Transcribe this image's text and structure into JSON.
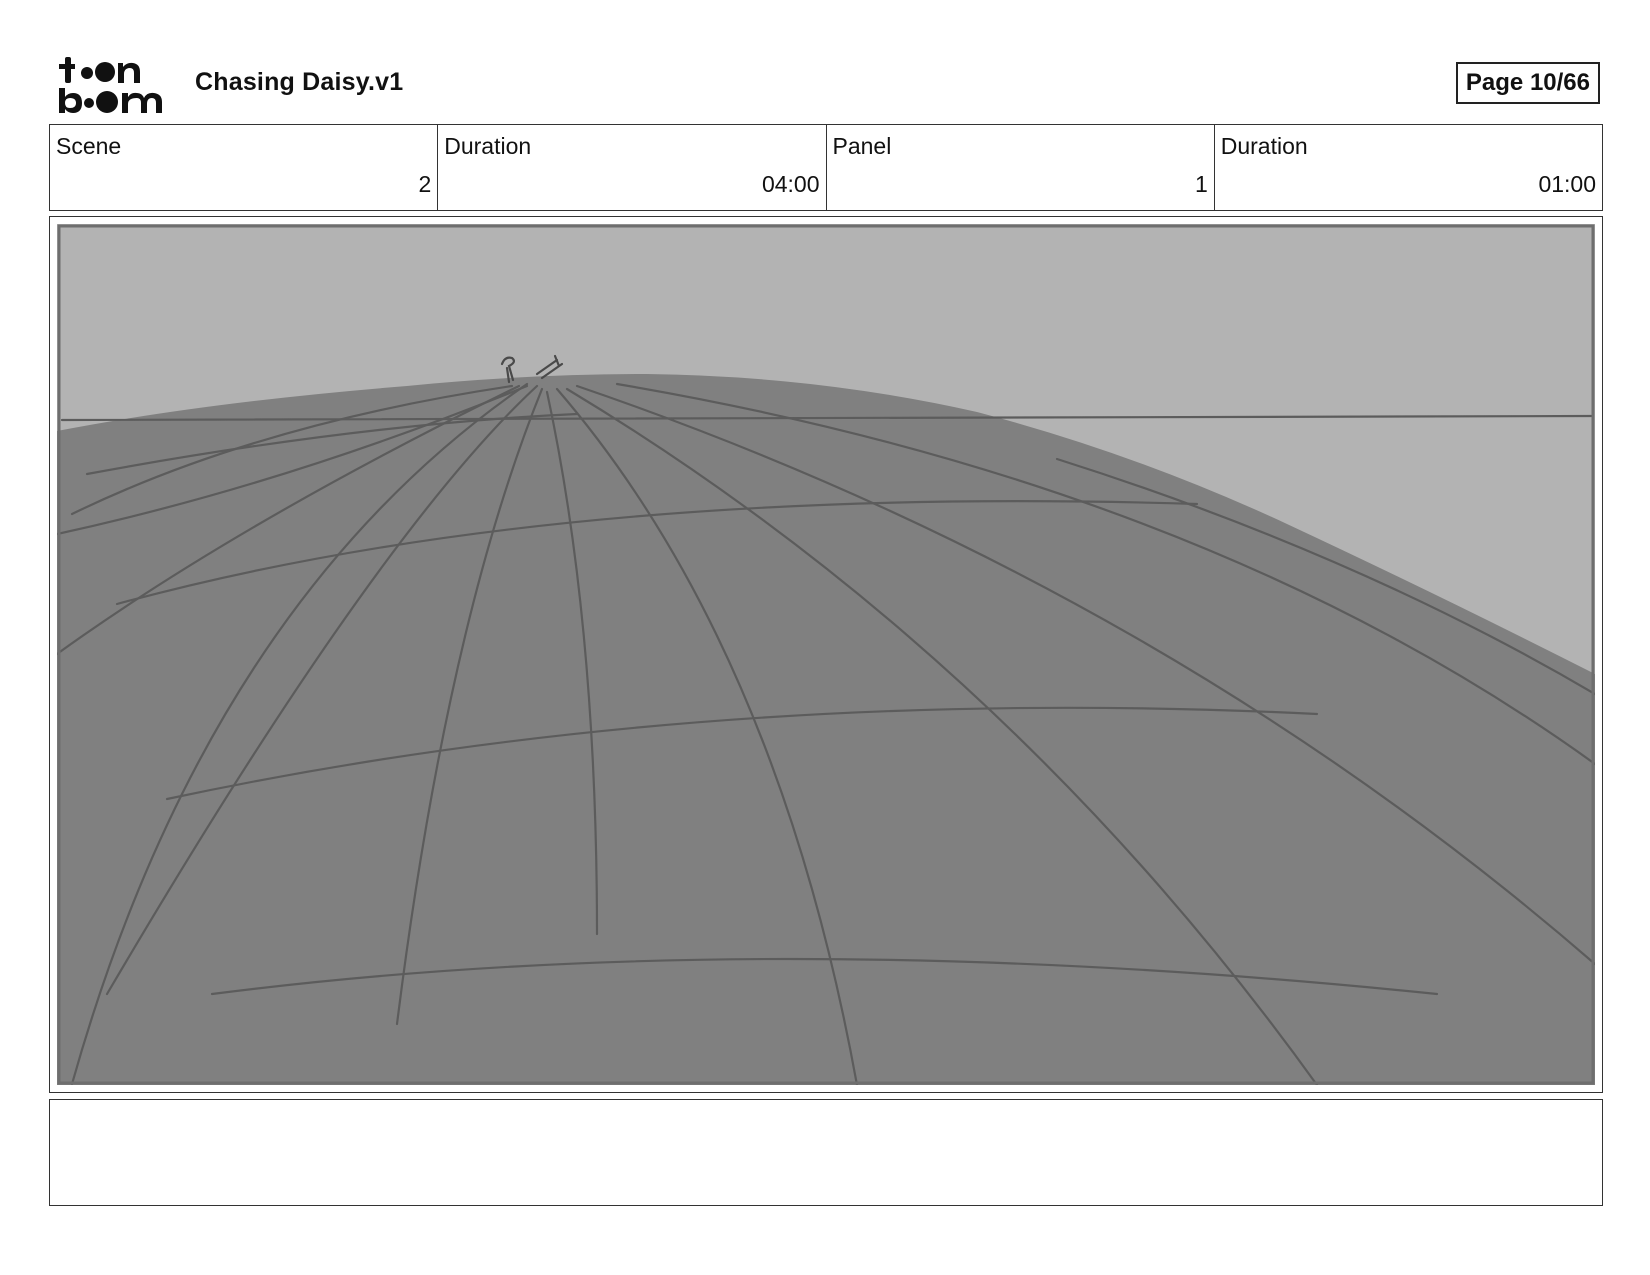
{
  "header": {
    "logo_line1": "toon",
    "logo_line2": "boom",
    "title": "Chasing Daisy.v1",
    "page_label": "Page 10/66"
  },
  "info": {
    "scene_label": "Scene",
    "scene_value": "2",
    "scene_duration_label": "Duration",
    "scene_duration_value": "04:00",
    "panel_label": "Panel",
    "panel_value": "1",
    "panel_duration_label": "Duration",
    "panel_duration_value": "01:00"
  },
  "panel": {
    "sky_color": "#b3b3b3",
    "ground_color": "#808080",
    "line_color": "#5c5c5c"
  },
  "caption": {
    "text": ""
  }
}
